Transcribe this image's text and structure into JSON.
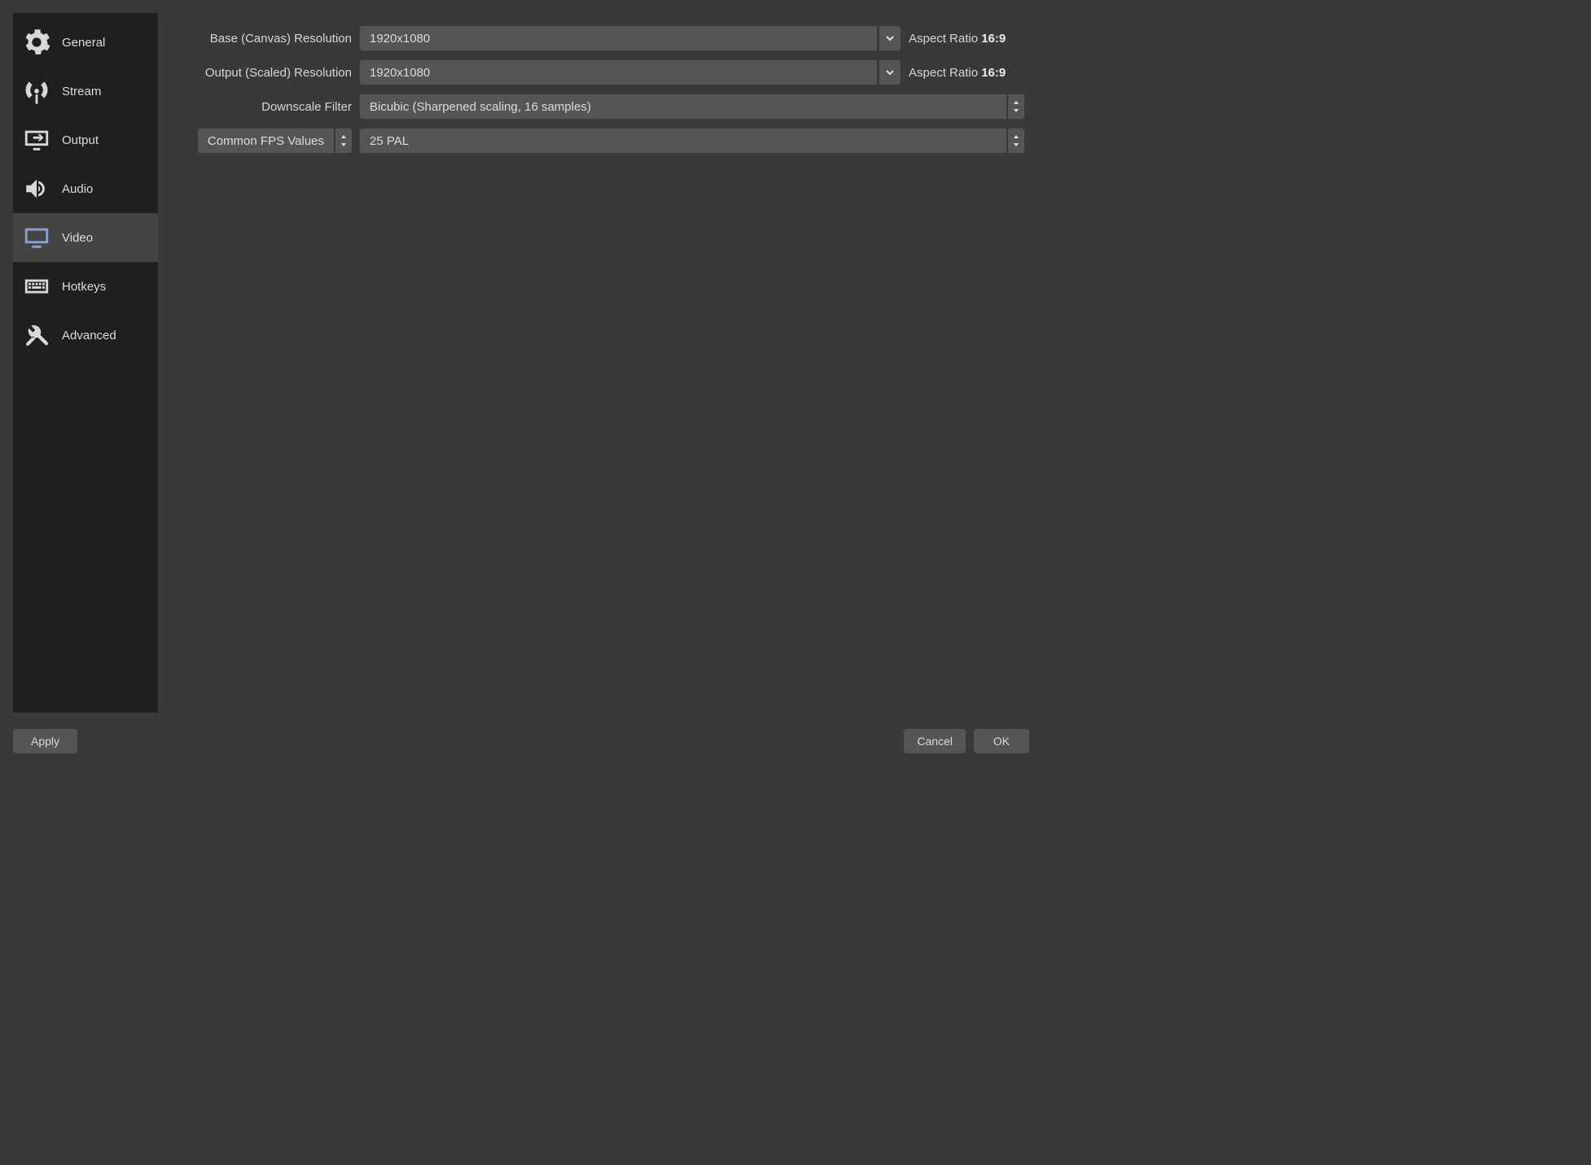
{
  "sidebar": {
    "items": [
      {
        "label": "General",
        "icon": "gear"
      },
      {
        "label": "Stream",
        "icon": "antenna"
      },
      {
        "label": "Output",
        "icon": "output"
      },
      {
        "label": "Audio",
        "icon": "speaker"
      },
      {
        "label": "Video",
        "icon": "monitor",
        "active": true
      },
      {
        "label": "Hotkeys",
        "icon": "keyboard"
      },
      {
        "label": "Advanced",
        "icon": "tools"
      }
    ]
  },
  "video": {
    "base_label": "Base (Canvas) Resolution",
    "base_value": "1920x1080",
    "base_aspect_label": "Aspect Ratio",
    "base_aspect_value": "16:9",
    "output_label": "Output (Scaled) Resolution",
    "output_value": "1920x1080",
    "output_aspect_label": "Aspect Ratio",
    "output_aspect_value": "16:9",
    "downscale_label": "Downscale Filter",
    "downscale_value": "Bicubic (Sharpened scaling, 16 samples)",
    "fps_type_label": "Common FPS Values",
    "fps_value": "25 PAL"
  },
  "buttons": {
    "apply": "Apply",
    "cancel": "Cancel",
    "ok": "OK"
  }
}
